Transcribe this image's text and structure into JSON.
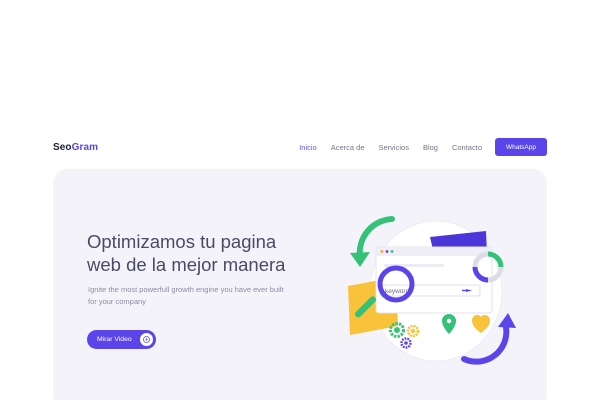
{
  "brand": {
    "part1": "Seo",
    "part2": "Gram"
  },
  "nav": {
    "items": [
      {
        "label": "Inicio",
        "active": true
      },
      {
        "label": "Acerca de",
        "active": false
      },
      {
        "label": "Servicios",
        "active": false
      },
      {
        "label": "Blog",
        "active": false
      },
      {
        "label": "Contacto",
        "active": false
      }
    ],
    "cta_label": "WhatsApp"
  },
  "hero": {
    "title_line1": "Optimizamos tu pagina",
    "title_line2": "web de la mejor manera",
    "subtitle": "Ignite the most powerfull growth engine you have ever built for your company",
    "video_button_label": "Mirar Video",
    "search_keyword": "keyword"
  },
  "colors": {
    "accent": "#5b45ea",
    "hero_bg": "#f4f3fa",
    "green": "#35c178",
    "yellow": "#f8c33b",
    "orange": "#f5a623"
  }
}
